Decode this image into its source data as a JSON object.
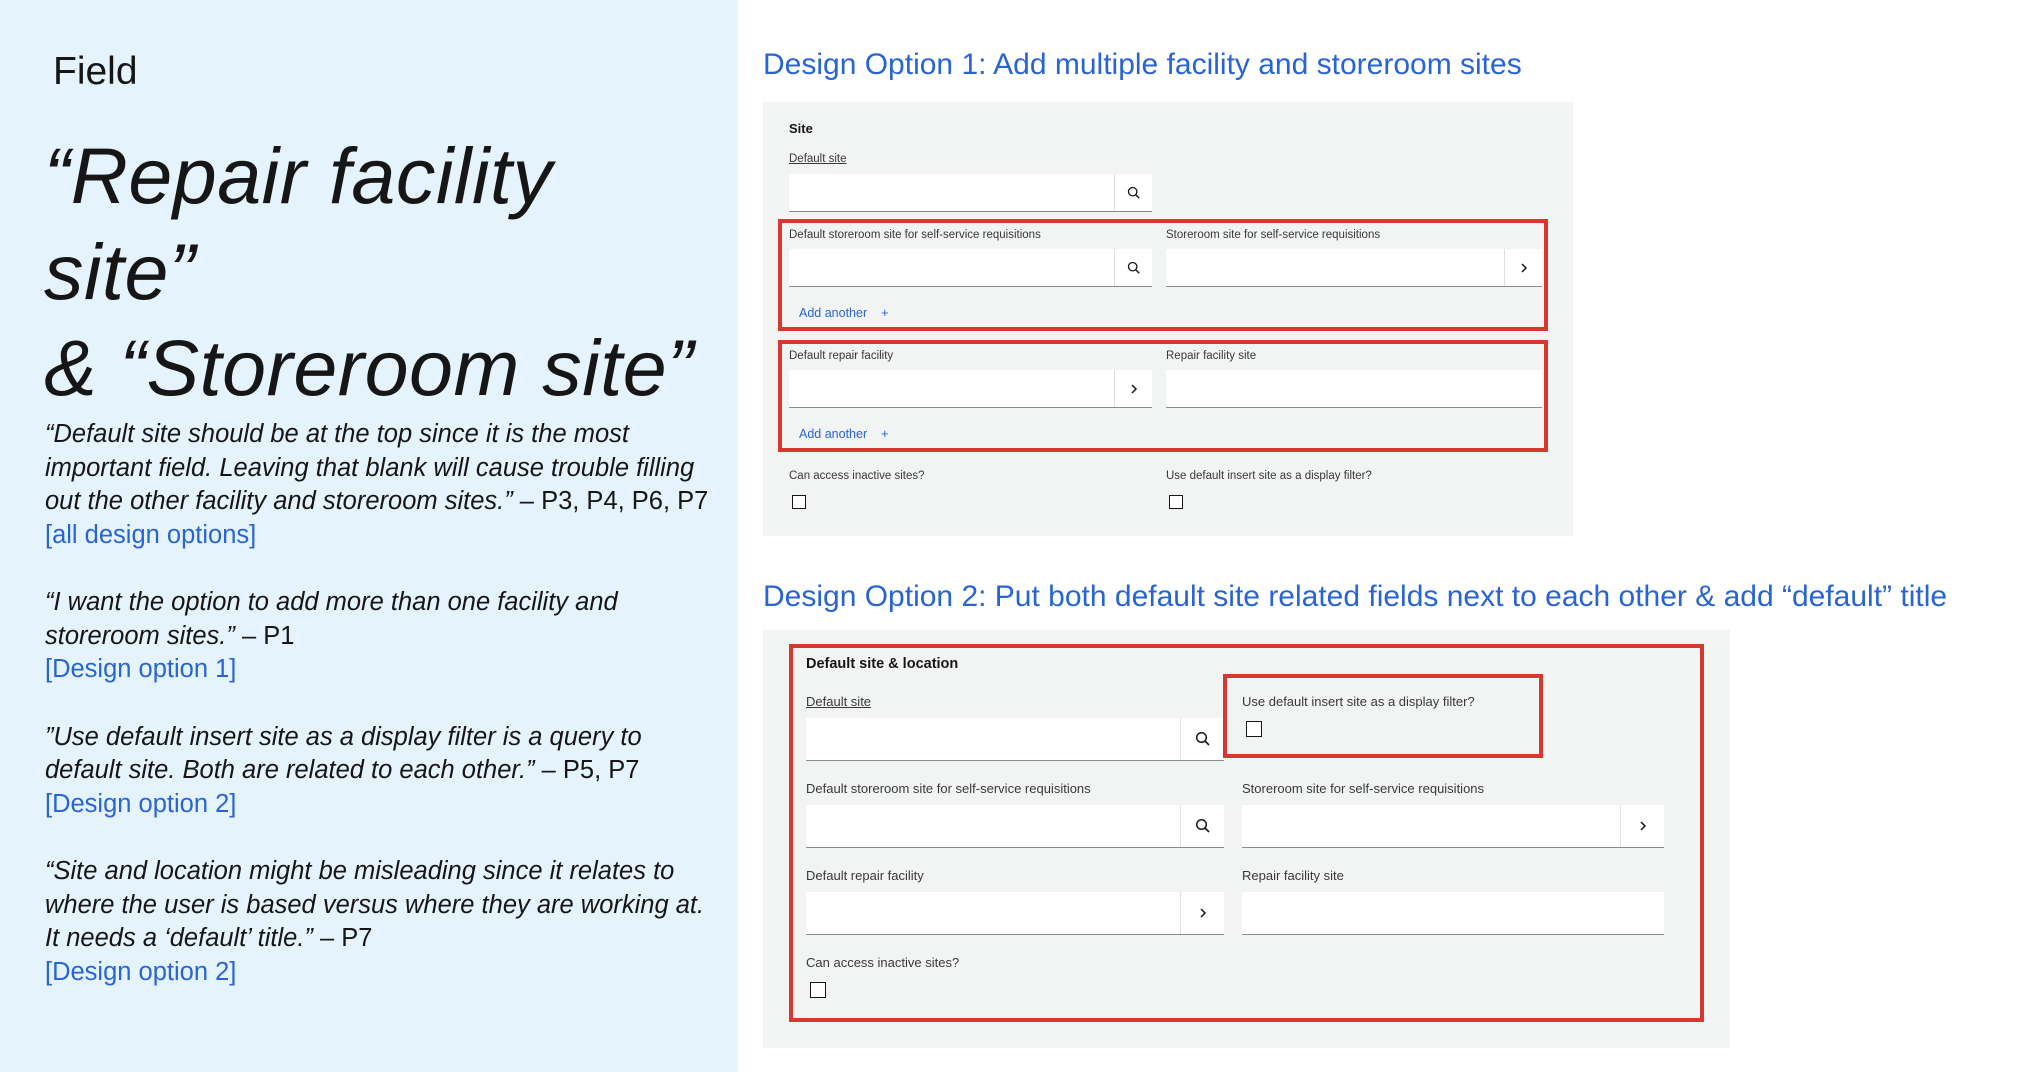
{
  "left": {
    "kicker": "Field",
    "title_line1": "“Repair facility site”",
    "title_line2": "& “Storeroom site”",
    "quotes": [
      {
        "text": "“Default site should be at the top since it is the most important field. Leaving that blank will cause trouble filling out the other facility and storeroom sites.”",
        "by": " – P3, P4, P6, P7",
        "ref": "[all design options]"
      },
      {
        "text": "“I want the option to add more than one facility and storeroom sites.”",
        "by": " – P1",
        "ref": "[Design option 1]"
      },
      {
        "text": "”Use default insert site as a display filter is a query to default site. Both are related to each other.”",
        "by": " – P5, P7",
        "ref": "[Design option 2]"
      },
      {
        "text": "“Site and location might be misleading since it relates to where the user is based versus where they are working at. It needs a ‘default’ title.”",
        "by": " – P7",
        "ref": "[Design option 2]"
      }
    ]
  },
  "option1": {
    "heading": "Design Option 1: Add multiple facility and storeroom sites",
    "section_title": "Site",
    "default_site_label": "Default site",
    "storeroom_label": "Default storeroom site for self-service requisitions",
    "storeroom_site_label": "Storeroom site for self-service requisitions",
    "add_another_1": "Add another",
    "repair_label": "Default repair facility",
    "repair_site_label": "Repair facility site",
    "add_another_2": "Add another",
    "inactive_label": "Can access inactive sites?",
    "display_filter_label": "Use default insert site as a display filter?"
  },
  "option2": {
    "heading": "Design Option 2: Put both default site related fields next to each other & add “default” title",
    "section_title": "Default site & location",
    "default_site_label": "Default site",
    "display_filter_label": "Use default insert site as a display filter?",
    "storeroom_label": "Default storeroom site for self-service requisitions",
    "storeroom_site_label": "Storeroom site for self-service requisitions",
    "repair_label": "Default repair facility",
    "repair_site_label": "Repair facility site",
    "inactive_label": "Can access inactive sites?"
  },
  "colors": {
    "accent": "#2864d6",
    "highlight": "#d6372f",
    "panel": "#f2f3f3",
    "left_bg": "#e5f3fd"
  }
}
